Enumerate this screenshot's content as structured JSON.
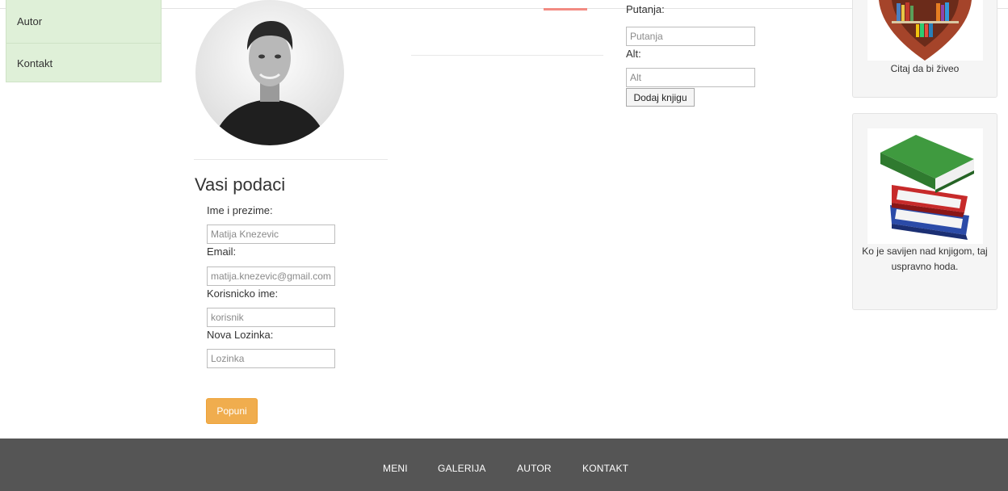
{
  "sidebar": {
    "items": [
      {
        "label": "Autor"
      },
      {
        "label": "Kontakt"
      }
    ]
  },
  "profile": {
    "form_title": "Vasi podaci",
    "fields": {
      "name": {
        "label": "Ime i prezime:",
        "value": "Matija Knezevic"
      },
      "email": {
        "label": "Email:",
        "value": "matija.knezevic@gmail.com"
      },
      "username": {
        "label": "Korisnicko ime:",
        "value": "korisnik"
      },
      "password": {
        "label": "Nova Lozinka:",
        "placeholder": "Lozinka"
      }
    },
    "submit_label": "Popuni"
  },
  "add_book": {
    "path_label": "Putanja:",
    "path_placeholder": "Putanja",
    "alt_label": "Alt:",
    "alt_placeholder": "Alt",
    "submit_label": "Dodaj knjigu"
  },
  "cards": [
    {
      "caption": "Citaj da bi živeo",
      "icon": "book-heart-icon"
    },
    {
      "caption": "Ko je savijen nad knjigom, taj uspravno hoda.",
      "icon": "book-stack-icon"
    }
  ],
  "footer": {
    "links": [
      "MENI",
      "GALERIJA",
      "AUTOR",
      "KONTAKT"
    ]
  },
  "colors": {
    "sidebar_bg": "#dff0d8",
    "submit_orange": "#f0ad4e",
    "footer_bg": "#555555",
    "accent_red": "#f28b82"
  }
}
